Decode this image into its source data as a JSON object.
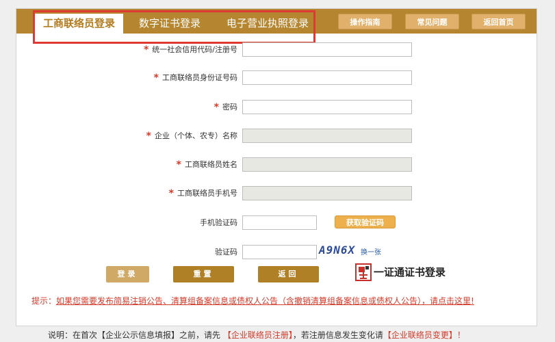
{
  "tabs": [
    {
      "label": "工商联络员登录",
      "active": true
    },
    {
      "label": "数字证书登录",
      "active": false
    },
    {
      "label": "电子营业执照登录",
      "active": false
    }
  ],
  "top_buttons": {
    "guide": "操作指南",
    "faq": "常见问题",
    "home": "返回首页"
  },
  "required_mark": "*",
  "fields": {
    "credit_code": {
      "label": "统一社会信用代码/注册号",
      "value": "",
      "required": true
    },
    "id_number": {
      "label": "工商联络员身份证号码",
      "value": "",
      "required": true
    },
    "password": {
      "label": "密码",
      "value": "",
      "required": true
    },
    "company_name": {
      "label": "企业（个体、农专）名称",
      "value": "",
      "required": true
    },
    "liaison_name": {
      "label": "工商联络员姓名",
      "value": "",
      "required": true
    },
    "liaison_phone": {
      "label": "工商联络员手机号",
      "value": "",
      "required": true
    },
    "sms_code": {
      "label": "手机验证码",
      "value": "",
      "required": false
    },
    "captcha": {
      "label": "验证码",
      "value": "",
      "required": false
    }
  },
  "sms_button": "获取验证码",
  "captcha_image_text": "A9N6X",
  "captcha_refresh": "换一张",
  "actions": {
    "login": "登录",
    "reset": "重置",
    "back": "返回"
  },
  "cert_login": "一证通证书登录",
  "tip": {
    "label": "提示：",
    "link": "如果您需要发布简易注销公告、清算组备案信息或债权人公告（含撤销清算组备案信息或债权人公告），请点击这里!"
  },
  "note": {
    "prefix": "说明：在首次【企业公示信息填报】之前，请先",
    "link1": "【企业联络员注册】",
    "middle": "，若注册信息发生变化请",
    "link2": "【企业联络员变更】",
    "suffix": "！"
  },
  "colors": {
    "brand": "#b5862f",
    "highlight": "#de3a34",
    "accent_button": "#edb04d",
    "link_red": "#d53a2a"
  }
}
